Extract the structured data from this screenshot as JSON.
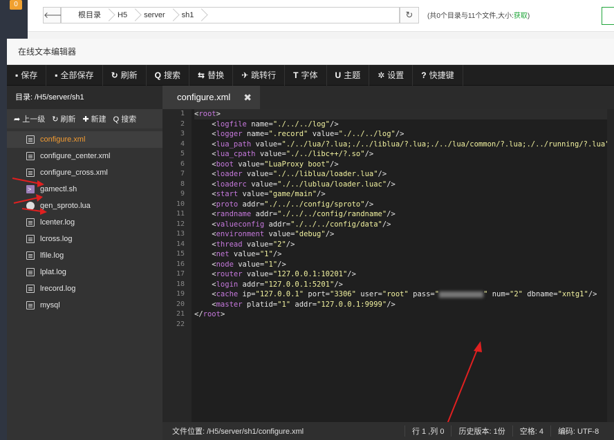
{
  "background": {
    "badge": "0",
    "breadcrumb": [
      "根目录",
      "H5",
      "server",
      "sh1"
    ],
    "info_prefix": "(共0个目录与11个文件,大小:",
    "info_link": "获取",
    "info_suffix": ")"
  },
  "editor": {
    "title": "在线文本编辑器",
    "toolbar": [
      {
        "icon": "save-icon",
        "glyph": "▪",
        "label": "保存"
      },
      {
        "icon": "save-all-icon",
        "glyph": "▪",
        "label": "全部保存"
      },
      {
        "icon": "refresh-icon",
        "glyph": "↻",
        "label": "刷新"
      },
      {
        "icon": "search-icon",
        "glyph": "Q",
        "label": "搜索"
      },
      {
        "icon": "replace-icon",
        "glyph": "⇆",
        "label": "替换"
      },
      {
        "icon": "goto-icon",
        "glyph": "✈",
        "label": "跳转行"
      },
      {
        "icon": "font-icon",
        "glyph": "T",
        "label": "字体"
      },
      {
        "icon": "theme-icon",
        "glyph": "U",
        "label": "主题"
      },
      {
        "icon": "settings-icon",
        "glyph": "✲",
        "label": "设置"
      },
      {
        "icon": "shortcut-icon",
        "glyph": "?",
        "label": "快捷键"
      }
    ],
    "directory_label": "目录: /H5/server/sh1",
    "file_actions": [
      {
        "icon": "up-icon",
        "glyph": "➦",
        "label": "上一级"
      },
      {
        "icon": "refresh-icon",
        "glyph": "↻",
        "label": "刷新"
      },
      {
        "icon": "plus-icon",
        "glyph": "✚",
        "label": "新建"
      },
      {
        "icon": "search-icon",
        "glyph": "Q",
        "label": "搜索"
      }
    ],
    "files": [
      {
        "name": "configure.xml",
        "type": "doc",
        "active": true
      },
      {
        "name": "configure_center.xml",
        "type": "doc",
        "active": false
      },
      {
        "name": "configure_cross.xml",
        "type": "doc",
        "active": false
      },
      {
        "name": "gamectl.sh",
        "type": "term",
        "active": false
      },
      {
        "name": "gen_sproto.lua",
        "type": "bug",
        "active": false
      },
      {
        "name": "lcenter.log",
        "type": "doc",
        "active": false
      },
      {
        "name": "lcross.log",
        "type": "doc",
        "active": false
      },
      {
        "name": "lfile.log",
        "type": "doc",
        "active": false
      },
      {
        "name": "lplat.log",
        "type": "doc",
        "active": false
      },
      {
        "name": "lrecord.log",
        "type": "doc",
        "active": false
      },
      {
        "name": "mysql",
        "type": "doc",
        "active": false
      }
    ],
    "tab": {
      "label": "configure.xml",
      "close": "✖"
    },
    "code_lines": [
      [
        [
          "tg",
          "<"
        ],
        [
          "tn",
          "root"
        ],
        [
          "tg",
          ">"
        ]
      ],
      [
        [
          "tg",
          "    <"
        ],
        [
          "tn",
          "logfile"
        ],
        [
          "an",
          " name="
        ],
        [
          "av",
          "\"./../../log\""
        ],
        [
          "tg",
          "/>"
        ]
      ],
      [
        [
          "tg",
          "    <"
        ],
        [
          "tn",
          "logger"
        ],
        [
          "an",
          " name="
        ],
        [
          "av",
          "\".record\""
        ],
        [
          "an",
          " value="
        ],
        [
          "av",
          "\"./../../log\""
        ],
        [
          "tg",
          "/>"
        ]
      ],
      [
        [
          "tg",
          "    <"
        ],
        [
          "tn",
          "lua_path"
        ],
        [
          "an",
          " value="
        ],
        [
          "av",
          "\"./../lua/?.lua;./../liblua/?.lua;./../lua/common/?.lua;./../running/?.lua\""
        ]
      ],
      [
        [
          "tg",
          "    <"
        ],
        [
          "tn",
          "lua_cpath"
        ],
        [
          "an",
          " value="
        ],
        [
          "av",
          "\"./../libc++/?.so\""
        ],
        [
          "tg",
          "/>"
        ]
      ],
      [
        [
          "tg",
          "    <"
        ],
        [
          "tn",
          "boot"
        ],
        [
          "an",
          " value="
        ],
        [
          "av",
          "\"LuaProxy boot\""
        ],
        [
          "tg",
          "/>"
        ]
      ],
      [
        [
          "tg",
          "    <"
        ],
        [
          "tn",
          "loader"
        ],
        [
          "an",
          " value="
        ],
        [
          "av",
          "\"./../liblua/loader.lua\""
        ],
        [
          "tg",
          "/>"
        ]
      ],
      [
        [
          "tg",
          "    <"
        ],
        [
          "tn",
          "loaderc"
        ],
        [
          "an",
          " value="
        ],
        [
          "av",
          "\"./../lublua/loader.luac\""
        ],
        [
          "tg",
          "/>"
        ]
      ],
      [
        [
          "tg",
          "    <"
        ],
        [
          "tn",
          "start"
        ],
        [
          "an",
          " value="
        ],
        [
          "av",
          "\"game/main\""
        ],
        [
          "tg",
          "/>"
        ]
      ],
      [
        [
          "tg",
          "    <"
        ],
        [
          "tn",
          "proto"
        ],
        [
          "an",
          " addr="
        ],
        [
          "av",
          "\"./../../config/sproto\""
        ],
        [
          "tg",
          "/>"
        ]
      ],
      [
        [
          "tg",
          "    <"
        ],
        [
          "tn",
          "randname"
        ],
        [
          "an",
          " addr="
        ],
        [
          "av",
          "\"./../../config/randname\""
        ],
        [
          "tg",
          "/>"
        ]
      ],
      [
        [
          "tg",
          "    <"
        ],
        [
          "tn",
          "valueconfig"
        ],
        [
          "an",
          " addr="
        ],
        [
          "av",
          "\"./../../config/data\""
        ],
        [
          "tg",
          "/>"
        ]
      ],
      [
        [
          "tg",
          "    <"
        ],
        [
          "tn",
          "environment"
        ],
        [
          "an",
          " value="
        ],
        [
          "av",
          "\"debug\""
        ],
        [
          "tg",
          "/>"
        ]
      ],
      [
        [
          "tg",
          "    <"
        ],
        [
          "tn",
          "thread"
        ],
        [
          "an",
          " value="
        ],
        [
          "av",
          "\"2\""
        ],
        [
          "tg",
          "/>"
        ]
      ],
      [
        [
          "tg",
          "    <"
        ],
        [
          "tn",
          "net"
        ],
        [
          "an",
          " value="
        ],
        [
          "av",
          "\"1\""
        ],
        [
          "tg",
          "/>"
        ]
      ],
      [
        [
          "tg",
          "    <"
        ],
        [
          "tn",
          "node"
        ],
        [
          "an",
          " value="
        ],
        [
          "av",
          "\"1\""
        ],
        [
          "tg",
          "/>"
        ]
      ],
      [
        [
          "tg",
          "    <"
        ],
        [
          "tn",
          "router"
        ],
        [
          "an",
          " value="
        ],
        [
          "av",
          "\"127.0.0.1:10201\""
        ],
        [
          "tg",
          "/>"
        ]
      ],
      [
        [
          "tg",
          "    <"
        ],
        [
          "tn",
          "login"
        ],
        [
          "an",
          " addr="
        ],
        [
          "av",
          "\"127.0.0.1:5201\""
        ],
        [
          "tg",
          "/>"
        ]
      ],
      [
        [
          "tg",
          "    <"
        ],
        [
          "tn",
          "cache"
        ],
        [
          "an",
          " ip="
        ],
        [
          "av",
          "\"127.0.0.1\""
        ],
        [
          "an",
          " port="
        ],
        [
          "av",
          "\"3306\""
        ],
        [
          "an",
          " user="
        ],
        [
          "av",
          "\"root\""
        ],
        [
          "an",
          " pass="
        ],
        [
          "av",
          "\""
        ],
        [
          "blur",
          ""
        ],
        [
          "av",
          "\""
        ],
        [
          "an",
          " num="
        ],
        [
          "av",
          "\"2\""
        ],
        [
          "an",
          " dbname="
        ],
        [
          "av",
          "\"xntg1\""
        ],
        [
          "tg",
          "/>"
        ]
      ],
      [
        [
          "tg",
          "    <"
        ],
        [
          "tn",
          "master"
        ],
        [
          "an",
          " platid="
        ],
        [
          "av",
          "\"1\""
        ],
        [
          "an",
          " addr="
        ],
        [
          "av",
          "\"127.0.0.1:9999\""
        ],
        [
          "tg",
          "/>"
        ]
      ],
      [
        [
          "tg",
          "</"
        ],
        [
          "tn",
          "root"
        ],
        [
          "tg",
          ">"
        ]
      ],
      []
    ],
    "status": {
      "path": "文件位置: /H5/server/sh1/configure.xml",
      "position": "行 1 ,列 0",
      "history": "历史版本: 1份",
      "indent": "空格: 4",
      "encoding": "编码: UTF-8"
    }
  }
}
